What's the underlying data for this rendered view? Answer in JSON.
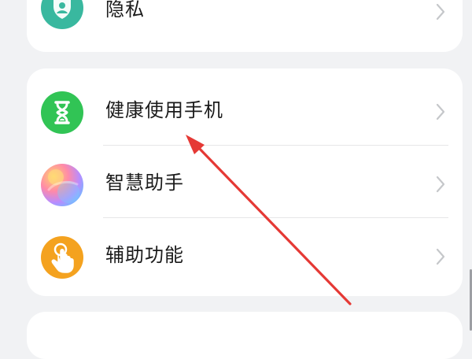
{
  "settings": {
    "items": [
      {
        "label": "隐私",
        "icon": "privacy-icon"
      },
      {
        "label": "健康使用手机",
        "icon": "hourglass-icon"
      },
      {
        "label": "智慧助手",
        "icon": "assistant-orb-icon"
      },
      {
        "label": "辅助功能",
        "icon": "hand-pointer-icon"
      }
    ]
  },
  "colors": {
    "background": "#f1f2f4",
    "card": "#ffffff",
    "privacy_icon_bg": "#39b89f",
    "health_icon_bg": "#31c455",
    "accessibility_icon_bg": "#f4a21f",
    "annotation_arrow": "#e53935"
  }
}
